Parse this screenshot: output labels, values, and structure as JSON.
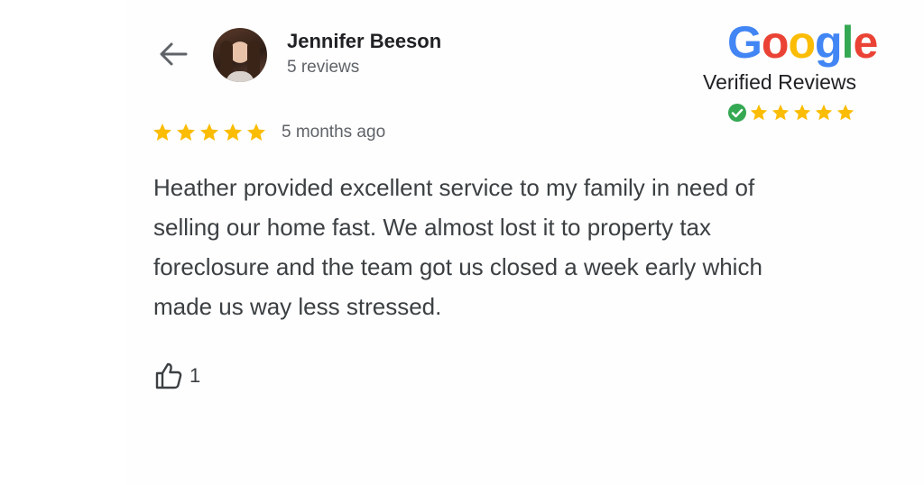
{
  "review": {
    "reviewer_name": "Jennifer Beeson",
    "reviewer_meta": "5 reviews",
    "rating": 5,
    "rating_max": 5,
    "time_ago": "5 months ago",
    "text": "Heather provided excellent service to my family in need of selling our home fast. We almost lost it to property tax foreclosure and the team got us closed a week early which made us way less stressed.",
    "like_count": "1"
  },
  "badge": {
    "brand_letters": [
      "G",
      "o",
      "o",
      "g",
      "l",
      "e"
    ],
    "brand_colors": [
      "#4285F4",
      "#EA4335",
      "#FBBC05",
      "#4285F4",
      "#34A853",
      "#EA4335"
    ],
    "verified_label": "Verified Reviews",
    "badge_stars": 5
  },
  "colors": {
    "star": "#FBBC04",
    "check": "#34A853",
    "icon": "#5f6368"
  },
  "icons": {
    "back": "arrow-left-icon",
    "like": "thumbs-up-icon",
    "check": "check-circle-icon"
  }
}
